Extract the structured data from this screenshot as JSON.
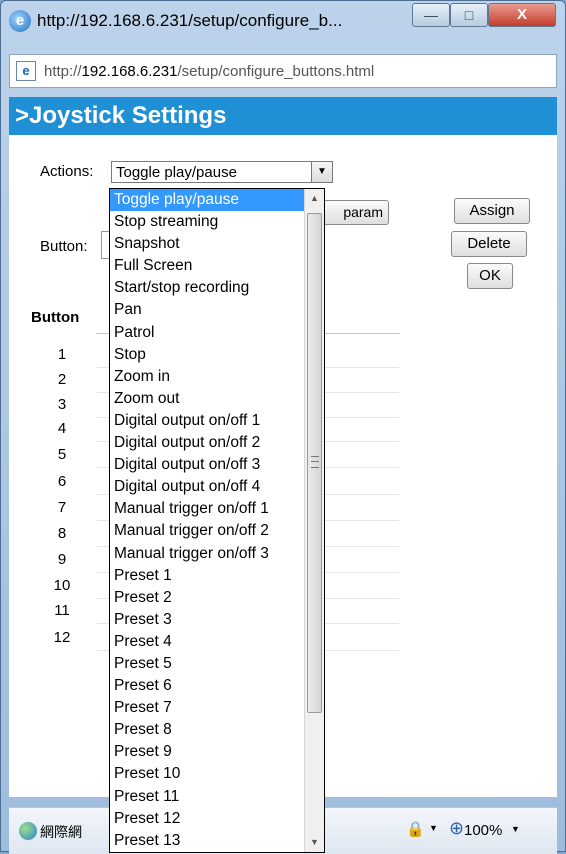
{
  "window": {
    "title": "http://192.168.6.231/setup/configure_b...",
    "minimize_label": "—",
    "maximize_label": "□",
    "close_label": "X"
  },
  "address": {
    "prefix": "http://",
    "domain": "192.168.6.231",
    "path": "/setup/configure_buttons.html"
  },
  "page": {
    "title": ">Joystick Settings",
    "actions_label": "Actions:",
    "selected_action": "Toggle play/pause",
    "param_label": "param",
    "assign_label": "Assign",
    "delete_label": "Delete",
    "ok_label": "OK",
    "button_label": "Button:"
  },
  "table": {
    "header": "Button",
    "rows": [
      "1",
      "2",
      "3",
      "4",
      "5",
      "6",
      "7",
      "8",
      "9",
      "10",
      "11",
      "12"
    ]
  },
  "dropdown": {
    "options": [
      "Toggle play/pause",
      "Stop streaming",
      "Snapshot",
      "Full Screen",
      "Start/stop recording",
      "Pan",
      "Patrol",
      "Stop",
      "Zoom in",
      "Zoom out",
      "Digital output on/off 1",
      "Digital output on/off 2",
      "Digital output on/off 3",
      "Digital output on/off 4",
      "Manual trigger on/off 1",
      "Manual trigger on/off 2",
      "Manual trigger on/off 3",
      "Preset 1",
      "Preset 2",
      "Preset 3",
      "Preset 4",
      "Preset 5",
      "Preset 6",
      "Preset 7",
      "Preset 8",
      "Preset 9",
      "Preset 10",
      "Preset 11",
      "Preset 12",
      "Preset 13"
    ],
    "selected_index": 0
  },
  "statusbar": {
    "zone_text": "網際網",
    "zoom": "100%"
  }
}
